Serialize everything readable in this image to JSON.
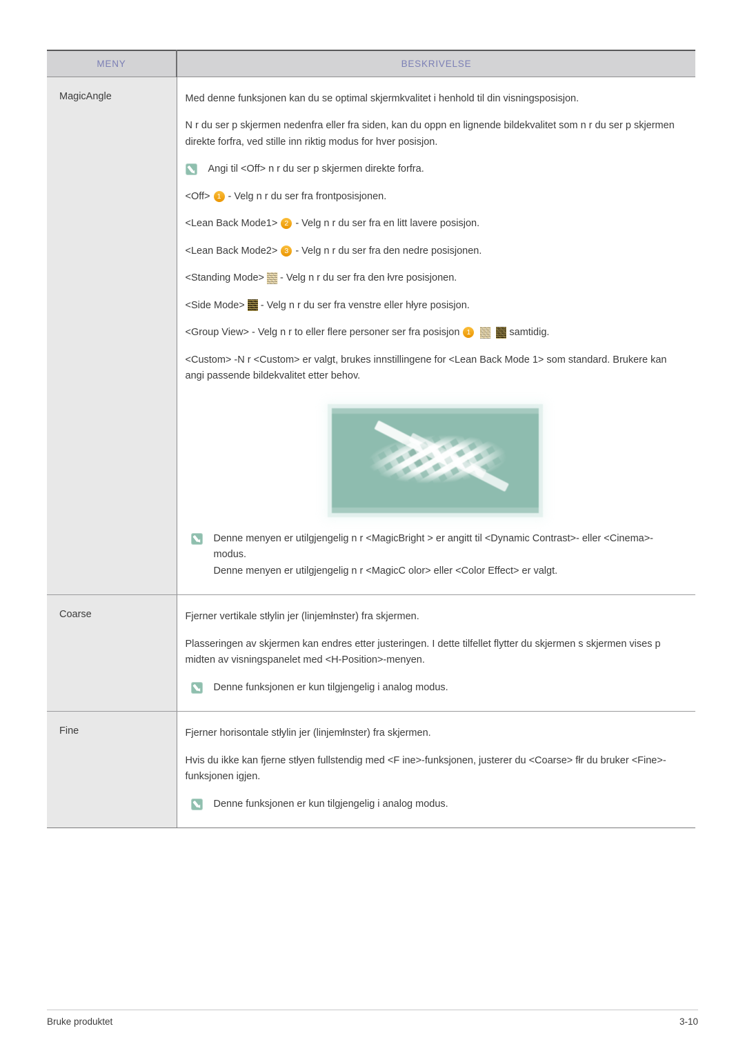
{
  "table": {
    "headers": {
      "menu": "MENY",
      "description": "BESKRIVELSE"
    },
    "rows": [
      {
        "menu": "MagicAngle",
        "intro": "Med denne funksjonen kan du se optimal skjermkvalitet i henhold til din visningsposisjon.",
        "intro2": "N r du ser p  skjermen nedenfra eller fra siden, kan du oppn  en lignende bildekvalitet som n r du ser p  skjermen direkte forfra, ved  stille inn riktig modus for hver posisjon.",
        "note_top": "Angi til <Off> n r du ser p  skjermen direkte forfra.",
        "modes": [
          {
            "label": "<Off>",
            "badge": "1",
            "desc": "- Velg n r du ser fra frontposisjonen."
          },
          {
            "label": "<Lean Back Mode1>",
            "badge": "2",
            "desc": "- Velg n r du ser fra en litt lavere posisjon."
          },
          {
            "label": "<Lean Back Mode2>",
            "badge": "3",
            "desc": "- Velg n r du ser fra den nedre posisjonen."
          },
          {
            "label": "<Standing Mode>",
            "badge": "icon-light",
            "desc": "- Velg n r du ser fra den łvre posisjonen."
          },
          {
            "label": "<Side Mode>",
            "badge": "icon-dark",
            "desc": "- Velg n r du ser fra venstre eller hłyre posisjon."
          }
        ],
        "group_view": {
          "prefix": "<Group View> - Velg n r to eller flere personer ser fra posisjon",
          "badge1": "1",
          "suffix": "samtidig."
        },
        "custom": "<Custom> -N r <Custom> er valgt, brukes  innstillingene for <Lean Back Mode 1> som standard. Brukere kan angi passende bildekvalitet etter behov.",
        "figure_alt": "magicangle-illustration",
        "notes_bottom": [
          "Denne menyen er utilgjengelig n r <MagicBright > er angitt til <Dynamic Contrast>- eller <Cinema>-modus.",
          "Denne menyen er utilgjengelig n r <MagicC olor> eller <Color Effect> er valgt."
        ]
      },
      {
        "menu": "Coarse",
        "p1": "Fjerner vertikale stłylin jer (linjemłnster) fra skjermen.",
        "p2": "Plasseringen av skjermen kan endres etter justeringen. I dette tilfellet flytter du skjermen s  skjermen vises p  midten av visningspanelet med <H-Position>-menyen.",
        "note": "Denne funksjonen er kun tilgjengelig i analog modus."
      },
      {
        "menu": "Fine",
        "p1": "Fjerner horisontale stłylin jer (linjemłnster) fra skjermen.",
        "p2": "Hvis du ikke kan fjerne stłyen fullstendig med <F ine>-funksjonen, justerer du <Coarse> fłr du bruker <Fine>-funksjonen igjen.",
        "note": "Denne funksjonen er kun tilgjengelig i analog modus."
      }
    ]
  },
  "footer": {
    "left": "Bruke produktet",
    "right": "3-10"
  },
  "colors": {
    "header_text": "#7b7fb5",
    "header_bg": "#d3d3d5",
    "menu_cell_bg": "#e8e8e8",
    "badge_orange": "#f5a623",
    "memo_icon_green": "#8fbfae",
    "figure_teal": "#8ebcaf",
    "body_text": "#3b3b3b"
  }
}
